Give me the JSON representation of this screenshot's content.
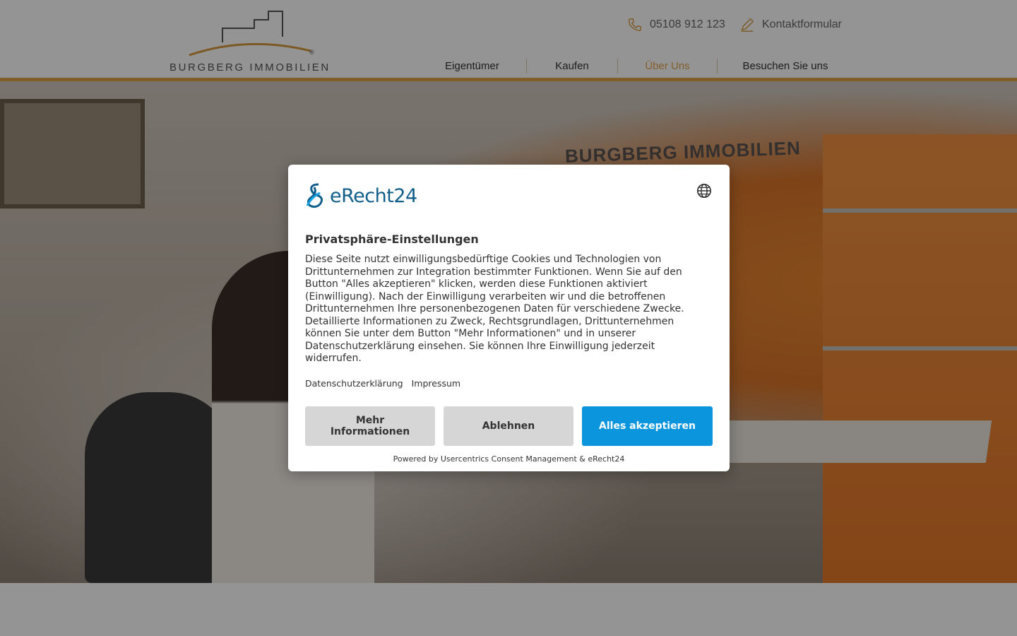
{
  "header": {
    "logo_text": "BURGBERG IMMOBILIEN",
    "phone": "05108 912 123",
    "contact_form": "Kontaktformular",
    "nav": [
      {
        "label": "Eigentümer",
        "active": false
      },
      {
        "label": "Kaufen",
        "active": false
      },
      {
        "label": "Über Uns",
        "active": true
      },
      {
        "label": "Besuchen Sie uns",
        "active": false
      }
    ],
    "accent_color": "#e0a24a"
  },
  "hero": {
    "wall_logo_text": "BURGBERG IMMOBILIEN"
  },
  "consent": {
    "brand": "eRecht24",
    "title": "Privatsphäre-Einstellungen",
    "body": "Diese Seite nutzt einwilligungsbedürftige Cookies und Technologien von Drittunternehmen zur Integration bestimmter Funktionen. Wenn Sie auf den Button \"Alles akzeptieren\" klicken, werden diese Funktionen aktiviert (Einwilligung). Nach der Einwilligung verarbeiten wir und die betroffenen Drittunternehmen Ihre personenbezogenen Daten für verschiedene Zwecke. Detaillierte Informationen zu Zweck, Rechtsgrundlagen, Drittunternehmen können Sie unter dem Button \"Mehr Informationen\" und in unserer Datenschutzerklärung einsehen. Sie können Ihre Einwilligung jederzeit widerrufen.",
    "link_privacy": "Datenschutzerklärung",
    "link_imprint": "Impressum",
    "btn_more": "Mehr Informationen",
    "btn_decline": "Ablehnen",
    "btn_accept": "Alles akzeptieren",
    "powered_by": "Powered by Usercentrics Consent Management & eRecht24",
    "accept_color": "#0b95dc",
    "language_icon": "globe-icon"
  }
}
